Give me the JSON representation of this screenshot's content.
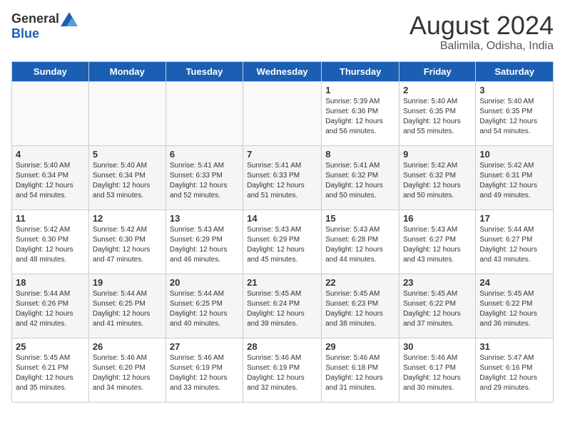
{
  "header": {
    "logo_general": "General",
    "logo_blue": "Blue",
    "month_year": "August 2024",
    "location": "Balimila, Odisha, India"
  },
  "days_of_week": [
    "Sunday",
    "Monday",
    "Tuesday",
    "Wednesday",
    "Thursday",
    "Friday",
    "Saturday"
  ],
  "weeks": [
    [
      {
        "day": "",
        "info": ""
      },
      {
        "day": "",
        "info": ""
      },
      {
        "day": "",
        "info": ""
      },
      {
        "day": "",
        "info": ""
      },
      {
        "day": "1",
        "info": "Sunrise: 5:39 AM\nSunset: 6:36 PM\nDaylight: 12 hours\nand 56 minutes."
      },
      {
        "day": "2",
        "info": "Sunrise: 5:40 AM\nSunset: 6:35 PM\nDaylight: 12 hours\nand 55 minutes."
      },
      {
        "day": "3",
        "info": "Sunrise: 5:40 AM\nSunset: 6:35 PM\nDaylight: 12 hours\nand 54 minutes."
      }
    ],
    [
      {
        "day": "4",
        "info": "Sunrise: 5:40 AM\nSunset: 6:34 PM\nDaylight: 12 hours\nand 54 minutes."
      },
      {
        "day": "5",
        "info": "Sunrise: 5:40 AM\nSunset: 6:34 PM\nDaylight: 12 hours\nand 53 minutes."
      },
      {
        "day": "6",
        "info": "Sunrise: 5:41 AM\nSunset: 6:33 PM\nDaylight: 12 hours\nand 52 minutes."
      },
      {
        "day": "7",
        "info": "Sunrise: 5:41 AM\nSunset: 6:33 PM\nDaylight: 12 hours\nand 51 minutes."
      },
      {
        "day": "8",
        "info": "Sunrise: 5:41 AM\nSunset: 6:32 PM\nDaylight: 12 hours\nand 50 minutes."
      },
      {
        "day": "9",
        "info": "Sunrise: 5:42 AM\nSunset: 6:32 PM\nDaylight: 12 hours\nand 50 minutes."
      },
      {
        "day": "10",
        "info": "Sunrise: 5:42 AM\nSunset: 6:31 PM\nDaylight: 12 hours\nand 49 minutes."
      }
    ],
    [
      {
        "day": "11",
        "info": "Sunrise: 5:42 AM\nSunset: 6:30 PM\nDaylight: 12 hours\nand 48 minutes."
      },
      {
        "day": "12",
        "info": "Sunrise: 5:42 AM\nSunset: 6:30 PM\nDaylight: 12 hours\nand 47 minutes."
      },
      {
        "day": "13",
        "info": "Sunrise: 5:43 AM\nSunset: 6:29 PM\nDaylight: 12 hours\nand 46 minutes."
      },
      {
        "day": "14",
        "info": "Sunrise: 5:43 AM\nSunset: 6:29 PM\nDaylight: 12 hours\nand 45 minutes."
      },
      {
        "day": "15",
        "info": "Sunrise: 5:43 AM\nSunset: 6:28 PM\nDaylight: 12 hours\nand 44 minutes."
      },
      {
        "day": "16",
        "info": "Sunrise: 5:43 AM\nSunset: 6:27 PM\nDaylight: 12 hours\nand 43 minutes."
      },
      {
        "day": "17",
        "info": "Sunrise: 5:44 AM\nSunset: 6:27 PM\nDaylight: 12 hours\nand 43 minutes."
      }
    ],
    [
      {
        "day": "18",
        "info": "Sunrise: 5:44 AM\nSunset: 6:26 PM\nDaylight: 12 hours\nand 42 minutes."
      },
      {
        "day": "19",
        "info": "Sunrise: 5:44 AM\nSunset: 6:25 PM\nDaylight: 12 hours\nand 41 minutes."
      },
      {
        "day": "20",
        "info": "Sunrise: 5:44 AM\nSunset: 6:25 PM\nDaylight: 12 hours\nand 40 minutes."
      },
      {
        "day": "21",
        "info": "Sunrise: 5:45 AM\nSunset: 6:24 PM\nDaylight: 12 hours\nand 39 minutes."
      },
      {
        "day": "22",
        "info": "Sunrise: 5:45 AM\nSunset: 6:23 PM\nDaylight: 12 hours\nand 38 minutes."
      },
      {
        "day": "23",
        "info": "Sunrise: 5:45 AM\nSunset: 6:22 PM\nDaylight: 12 hours\nand 37 minutes."
      },
      {
        "day": "24",
        "info": "Sunrise: 5:45 AM\nSunset: 6:22 PM\nDaylight: 12 hours\nand 36 minutes."
      }
    ],
    [
      {
        "day": "25",
        "info": "Sunrise: 5:45 AM\nSunset: 6:21 PM\nDaylight: 12 hours\nand 35 minutes."
      },
      {
        "day": "26",
        "info": "Sunrise: 5:46 AM\nSunset: 6:20 PM\nDaylight: 12 hours\nand 34 minutes."
      },
      {
        "day": "27",
        "info": "Sunrise: 5:46 AM\nSunset: 6:19 PM\nDaylight: 12 hours\nand 33 minutes."
      },
      {
        "day": "28",
        "info": "Sunrise: 5:46 AM\nSunset: 6:19 PM\nDaylight: 12 hours\nand 32 minutes."
      },
      {
        "day": "29",
        "info": "Sunrise: 5:46 AM\nSunset: 6:18 PM\nDaylight: 12 hours\nand 31 minutes."
      },
      {
        "day": "30",
        "info": "Sunrise: 5:46 AM\nSunset: 6:17 PM\nDaylight: 12 hours\nand 30 minutes."
      },
      {
        "day": "31",
        "info": "Sunrise: 5:47 AM\nSunset: 6:16 PM\nDaylight: 12 hours\nand 29 minutes."
      }
    ]
  ]
}
